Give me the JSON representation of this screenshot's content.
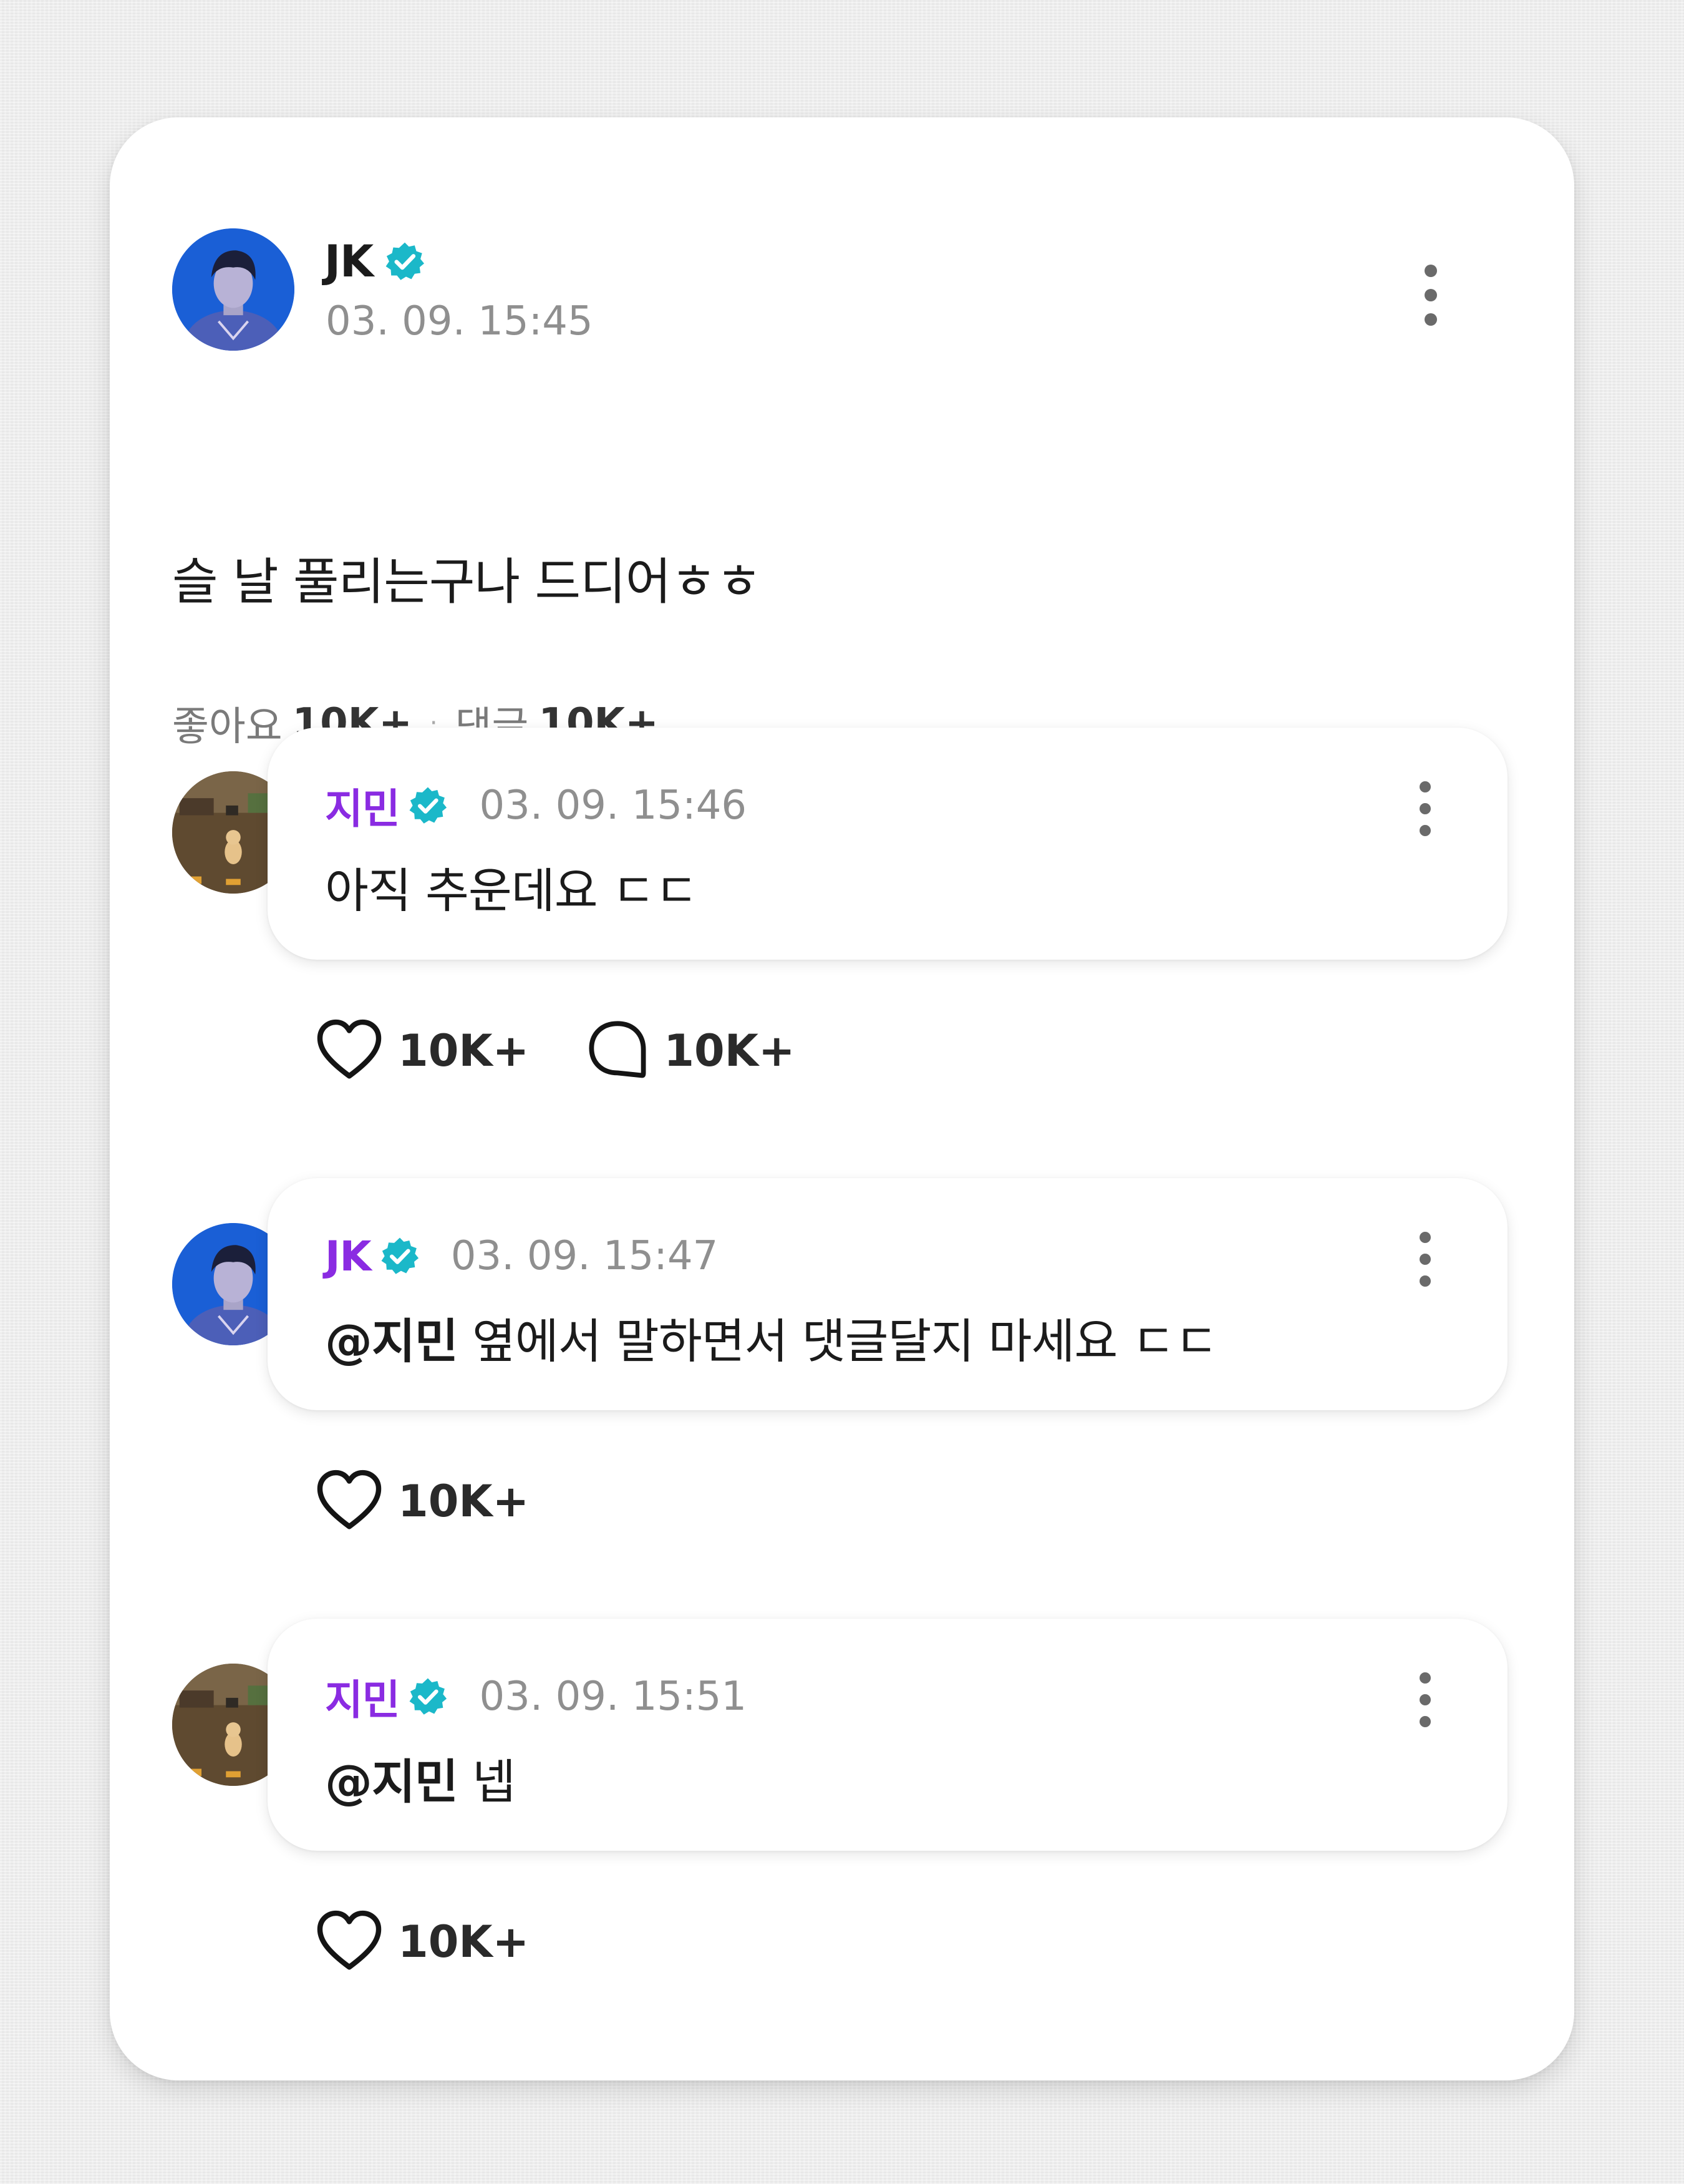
{
  "post": {
    "author": "JK",
    "verified_icon": "verified-badge-icon",
    "time": "03. 09. 15:45",
    "body": "슬 날 풀리는구나 드디어ㅎㅎ",
    "likes_label": "좋아요",
    "likes_count": "10K+",
    "separator": "·",
    "comments_label": "댓글",
    "comments_count": "10K+"
  },
  "comments": [
    {
      "author": "지민",
      "time": "03. 09. 15:46",
      "mention": "",
      "text": "아직 추운데요 ㄷㄷ",
      "likes": "10K+",
      "replies": "10K+"
    },
    {
      "author": "JK",
      "time": "03. 09. 15:47",
      "mention": "@지민",
      "text": " 옆에서 말하면서 댓글달지 마세요 ㄷㄷ",
      "likes": "10K+"
    },
    {
      "author": "지민",
      "time": "03. 09. 15:51",
      "mention": "@지민",
      "text": " 넵",
      "likes": "10K+"
    }
  ],
  "colors": {
    "accent_name": "#8a2be2",
    "verified": "#1bb8c9",
    "timestamp": "#8f8f8f"
  }
}
